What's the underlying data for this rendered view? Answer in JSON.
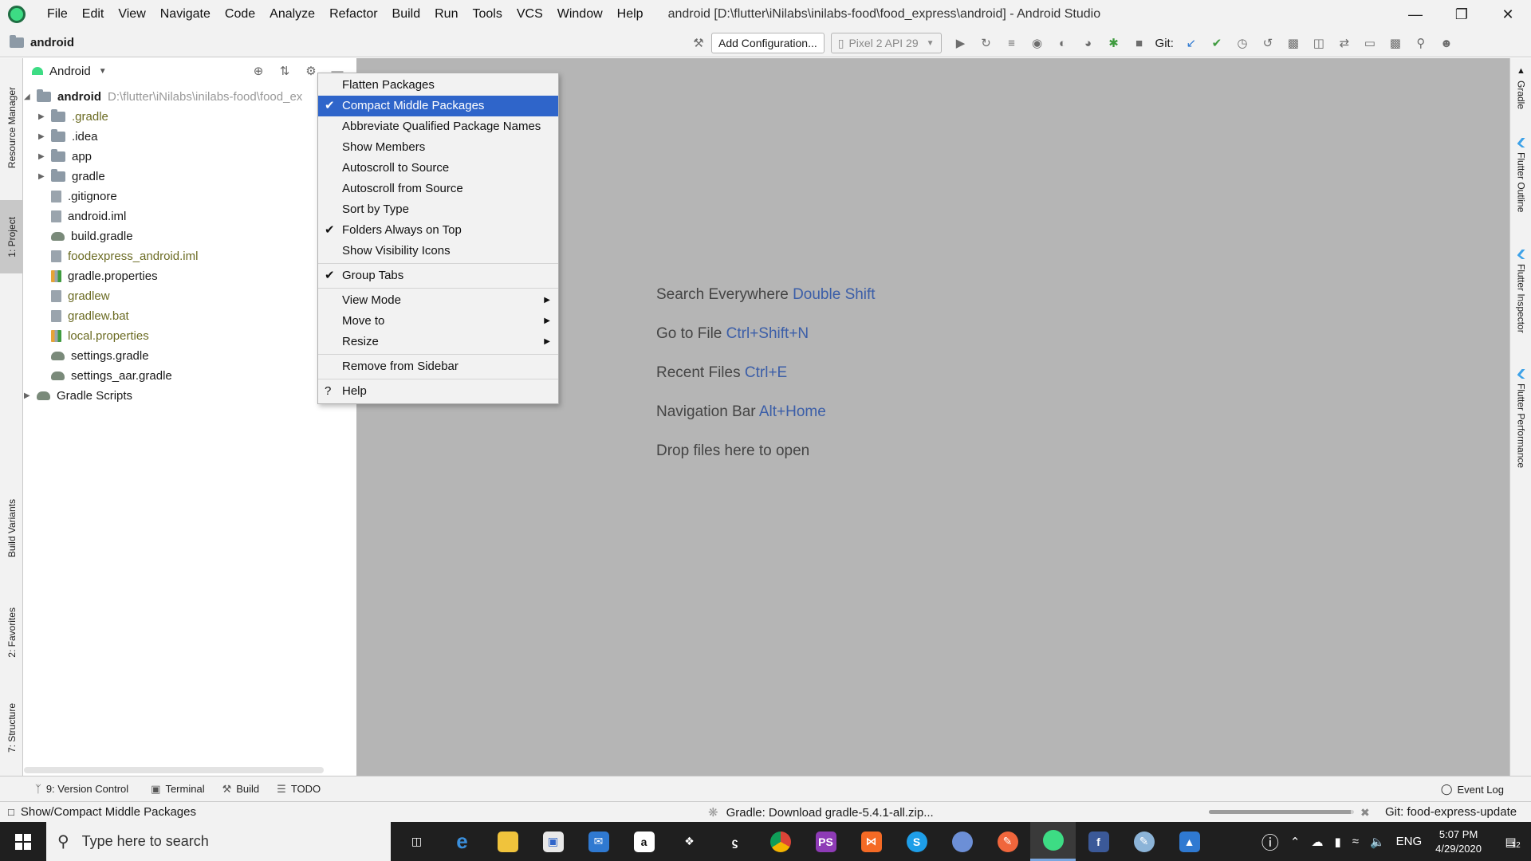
{
  "window": {
    "menu": [
      "File",
      "Edit",
      "View",
      "Navigate",
      "Code",
      "Analyze",
      "Refactor",
      "Build",
      "Run",
      "Tools",
      "VCS",
      "Window",
      "Help"
    ],
    "title": "android [D:\\flutter\\iNilabs\\inilabs-food\\food_express\\android] - Android Studio",
    "controls": [
      "minimize",
      "restore",
      "close"
    ]
  },
  "toolbar": {
    "project_crumb": "android",
    "add_configuration": "Add Configuration...",
    "device": "Pixel 2 API 29",
    "git_label": "Git:"
  },
  "left_strip": {
    "tabs": [
      "Resource Manager",
      "1: Project",
      "Build Variants",
      "2: Favorites",
      "7: Structure"
    ]
  },
  "right_strip": {
    "tabs": [
      "Gradle",
      "Flutter Outline",
      "Flutter Inspector",
      "Flutter Performance"
    ]
  },
  "project_panel": {
    "view": "Android",
    "root": {
      "name": "android",
      "path": "D:\\flutter\\iNilabs\\inilabs-food\\food_ex"
    },
    "items": [
      {
        "name": ".gradle",
        "kind": "folder",
        "expandable": true,
        "color": "olive"
      },
      {
        "name": ".idea",
        "kind": "folder",
        "expandable": true,
        "color": "normal"
      },
      {
        "name": "app",
        "kind": "folder",
        "expandable": true,
        "color": "normal"
      },
      {
        "name": "gradle",
        "kind": "folder",
        "expandable": true,
        "color": "normal"
      },
      {
        "name": ".gitignore",
        "kind": "file",
        "expandable": false,
        "color": "normal"
      },
      {
        "name": "android.iml",
        "kind": "file",
        "expandable": false,
        "color": "normal"
      },
      {
        "name": "build.gradle",
        "kind": "gradle",
        "expandable": false,
        "color": "normal"
      },
      {
        "name": "foodexpress_android.iml",
        "kind": "file",
        "expandable": false,
        "color": "olive"
      },
      {
        "name": "gradle.properties",
        "kind": "props",
        "expandable": false,
        "color": "normal"
      },
      {
        "name": "gradlew",
        "kind": "file",
        "expandable": false,
        "color": "olive"
      },
      {
        "name": "gradlew.bat",
        "kind": "file",
        "expandable": false,
        "color": "olive"
      },
      {
        "name": "local.properties",
        "kind": "props",
        "expandable": false,
        "color": "olive"
      },
      {
        "name": "settings.gradle",
        "kind": "gradle",
        "expandable": false,
        "color": "normal"
      },
      {
        "name": "settings_aar.gradle",
        "kind": "gradle",
        "expandable": false,
        "color": "normal"
      }
    ],
    "gradle_scripts": "Gradle Scripts"
  },
  "context_menu": {
    "items": [
      {
        "label": "Flatten Packages",
        "checked": false,
        "submenu": false,
        "highlighted": false
      },
      {
        "label": "Compact Middle Packages",
        "checked": true,
        "submenu": false,
        "highlighted": true
      },
      {
        "label": "Abbreviate Qualified Package Names",
        "checked": false,
        "submenu": false,
        "highlighted": false
      },
      {
        "label": "Show Members",
        "checked": false,
        "submenu": false,
        "highlighted": false
      },
      {
        "label": "Autoscroll to Source",
        "checked": false,
        "submenu": false,
        "highlighted": false
      },
      {
        "label": "Autoscroll from Source",
        "checked": false,
        "submenu": false,
        "highlighted": false
      },
      {
        "label": "Sort by Type",
        "checked": false,
        "submenu": false,
        "highlighted": false
      },
      {
        "label": "Folders Always on Top",
        "checked": true,
        "submenu": false,
        "highlighted": false
      },
      {
        "label": "Show Visibility Icons",
        "checked": false,
        "submenu": false,
        "highlighted": false
      },
      {
        "separator": true
      },
      {
        "label": "Group Tabs",
        "checked": true,
        "submenu": false,
        "highlighted": false
      },
      {
        "separator": true
      },
      {
        "label": "View Mode",
        "checked": false,
        "submenu": true,
        "highlighted": false
      },
      {
        "label": "Move to",
        "checked": false,
        "submenu": true,
        "highlighted": false
      },
      {
        "label": "Resize",
        "checked": false,
        "submenu": true,
        "highlighted": false
      },
      {
        "separator": true
      },
      {
        "label": "Remove from Sidebar",
        "checked": false,
        "submenu": false,
        "highlighted": false
      },
      {
        "separator": true
      },
      {
        "label": "Help",
        "checked": false,
        "submenu": false,
        "highlighted": false,
        "icon": "?"
      }
    ]
  },
  "editor": {
    "hints": [
      {
        "text": "Search Everywhere",
        "key": "Double Shift"
      },
      {
        "text": "Go to File",
        "key": "Ctrl+Shift+N"
      },
      {
        "text": "Recent Files",
        "key": "Ctrl+E"
      },
      {
        "text": "Navigation Bar",
        "key": "Alt+Home"
      },
      {
        "text": "Drop files here to open",
        "key": ""
      }
    ]
  },
  "bottom_bar": {
    "version_control": "9: Version Control",
    "terminal": "Terminal",
    "build": "Build",
    "todo": "TODO",
    "event_log": "Event Log"
  },
  "status_bar": {
    "message": "Show/Compact Middle Packages",
    "progress_text": "Gradle: Download gradle-5.4.1-all.zip...",
    "progress_fraction": 0.98,
    "git_branch": "Git: food-express-update"
  },
  "taskbar": {
    "search_placeholder": "Type here to search",
    "language": "ENG",
    "time": "5:07 PM",
    "date": "4/29/2020",
    "notifications": "12"
  },
  "colors": {
    "accent": "#2f65ca",
    "editor_bg": "#b5b5b5",
    "key_hint": "#3b5ea8",
    "olive_file": "#6b6b23",
    "taskbar_bg": "#1f1f1f"
  }
}
